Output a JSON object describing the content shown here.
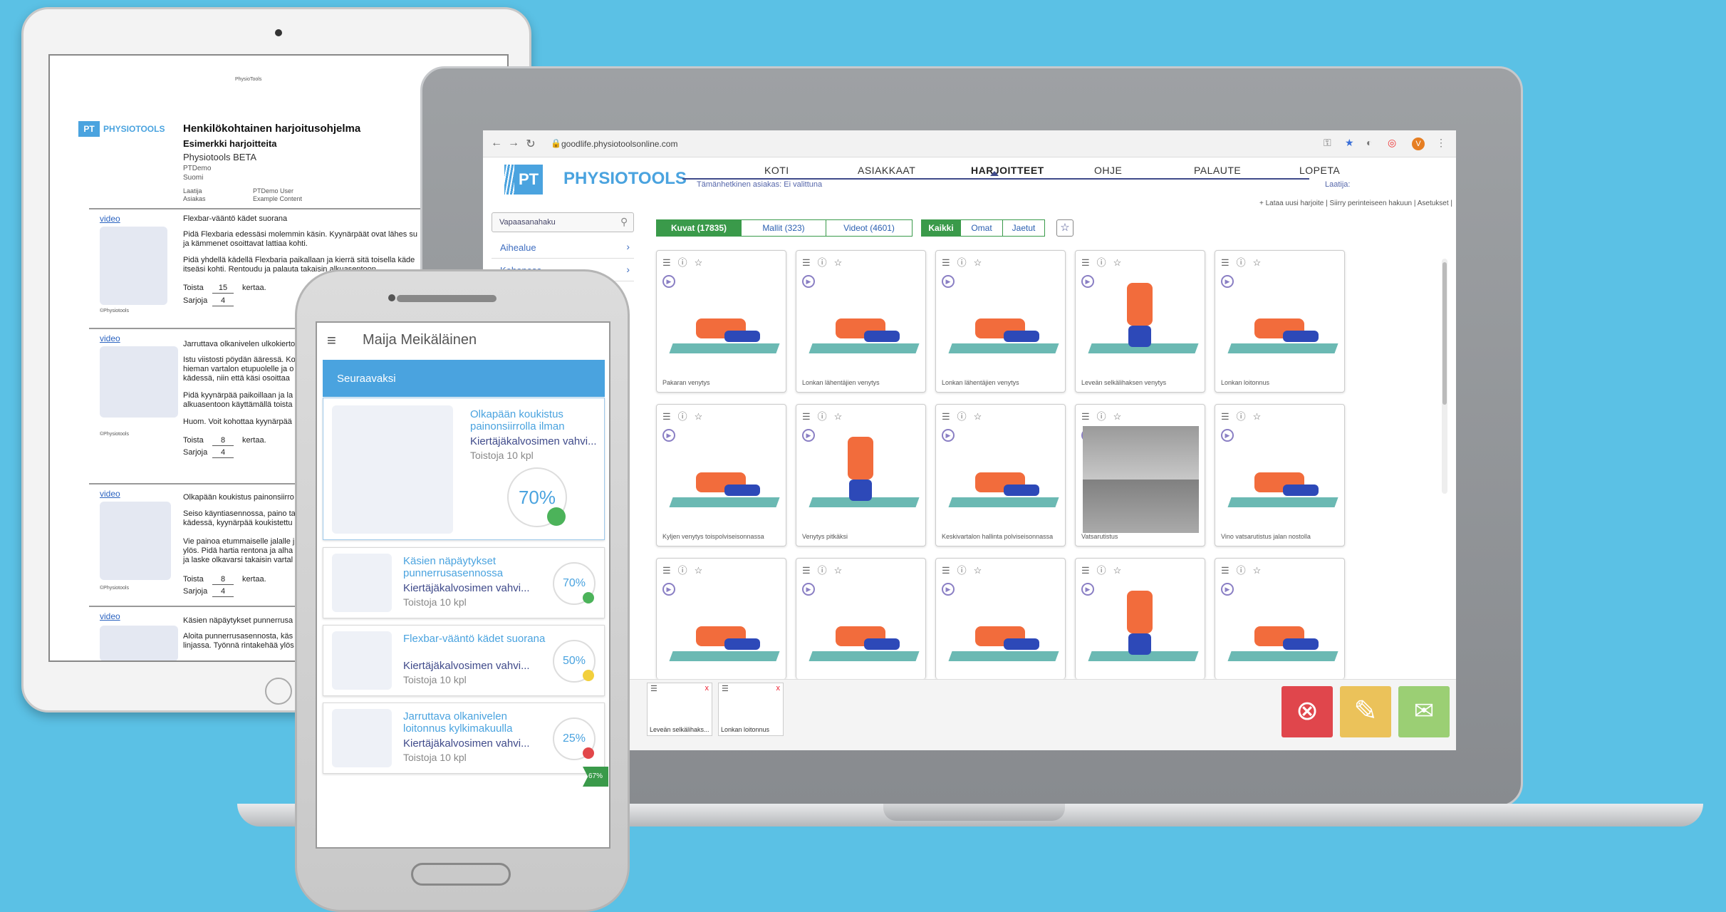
{
  "tablet": {
    "doc_brand": "PHYSIOTOOLS",
    "doc_logo_abbr": "PT",
    "doc_header_small": "PhysioTools",
    "title": "Henkilökohtainen harjoitusohjelma",
    "subtitle": "Esimerkki harjoitteita",
    "org": "Physiotools BETA",
    "org_line2": "PTDemo",
    "country": "Suomi",
    "creator_label": "Laatija",
    "creator_value": "PTDemo User",
    "client_label": "Asiakas",
    "client_value": "Example Content",
    "copyright": "©Physiotools",
    "exercises": [
      {
        "video": "video",
        "name": "Flexbar-vääntö kädet suorana",
        "text": [
          "Pidä Flexbaria edessäsi molemmin käsin. Kyynärpäät ovat lähes su",
          "ja kämmenet osoittavat lattiaa kohti.",
          "",
          "Pidä yhdellä kädellä Flexbaria paikallaan ja kierrä sitä toisella käde",
          "itseäsi kohti. Rentoudu ja palauta takaisin alkuasentoon."
        ],
        "reps_label": "Toista",
        "reps": "15",
        "reps_unit": "kertaa.",
        "sets_label": "Sarjoja",
        "sets": "4"
      },
      {
        "video": "video",
        "name": "Jarruttava olkanivelen ulkokierto",
        "text": [
          "Istu viistosti pöydän ääressä. Ko",
          "hieman vartalon etupuolelle ja o",
          "kädessä, niin että käsi osoittaa",
          "",
          "Pidä kyynärpää paikoillaan ja la",
          "alkuasentoon käyttämällä toista",
          "",
          "Huom. Voit kohottaa kyynärpää"
        ],
        "reps_label": "Toista",
        "reps": "8",
        "reps_unit": "kertaa.",
        "sets_label": "Sarjoja",
        "sets": "4"
      },
      {
        "video": "video",
        "name": "Olkapään koukistus painonsiirro",
        "text": [
          "Seiso käyntiasennossa, paino ta",
          "kädessä, kyynärpää koukistettu",
          "",
          "Vie painoa etummaiselle jalalle j",
          "ylös. Pidä hartia rentona ja alha",
          "ja laske olkavarsi takaisin vartal"
        ],
        "reps_label": "Toista",
        "reps": "8",
        "reps_unit": "kertaa.",
        "sets_label": "Sarjoja",
        "sets": "4"
      },
      {
        "video": "video",
        "name": "Käsien näpäytykset punnerrusa",
        "text": [
          "Aloita punnerrusasennosta, käs",
          "linjassa. Työnnä rintakehää ylös"
        ]
      }
    ]
  },
  "browser": {
    "url": "goodlife.physiotoolsonline.com",
    "user_initial": "V"
  },
  "app": {
    "logo_abbr": "PT",
    "brand": "PHYSIOTOOLS",
    "current_client": "Tämänhetkinen asiakas: Ei valittuna",
    "creator": "Laatija:",
    "nav": [
      "KOTI",
      "ASIAKKAAT",
      "HARJOITTEET",
      "OHJE",
      "PALAUTE",
      "LOPETA"
    ],
    "top_links": "+ Lataa uusi harjoite | Siirry perinteiseen hakuun | Asetukset |",
    "search_placeholder": "Vapaasanahaku",
    "sidebar": [
      "Aihealue",
      "Kehonosa"
    ],
    "media_tabs": [
      "Kuvat (17835)",
      "Mallit (323)",
      "Videot (4601)"
    ],
    "owner_tabs": [
      "Kaikki",
      "Omat",
      "Jaetut"
    ],
    "cards": [
      "Pakaran venytys",
      "Lonkan lähentäjien venytys",
      "Lonkan lähentäjien venytys",
      "Leveän selkälihaksen venytys",
      "Lonkan loitonnus",
      "Kyljen venytys toispolviseisonnassa",
      "Venytys pitkäksi",
      "Keskivartalon hallinta polviseisonnassa",
      "Vatsarutistus",
      "Vino vatsarutistus jalan nostolla",
      "",
      "",
      "",
      "",
      ""
    ],
    "tray": [
      "Leveän selkälihaks...",
      "Lonkan loitonnus"
    ]
  },
  "phone": {
    "user": "Maija  Meikäläinen",
    "next_label": "Seuraavaksi",
    "items": [
      {
        "title": "Olkapään koukistus painonsiirrolla ilman",
        "sub": "Kiertäjäkalvosimen vahvi...",
        "reps": "Toistoja 10 kpl",
        "pct": "70%",
        "color": "#4cb35a"
      },
      {
        "title": "Käsien näpäytykset punnerrusasennossa",
        "sub": "Kiertäjäkalvosimen vahvi...",
        "reps": "Toistoja 10 kpl",
        "pct": "70%",
        "color": "#4cb35a"
      },
      {
        "title": "Flexbar-vääntö kädet suorana",
        "sub": "Kiertäjäkalvosimen vahvi...",
        "reps": "Toistoja 10 kpl",
        "pct": "50%",
        "color": "#f2cf3c"
      },
      {
        "title": "Jarruttava olkanivelen loitonnus kylkimakuulla",
        "sub": "Kiertäjäkalvosimen vahvi...",
        "reps": "Toistoja 10 kpl",
        "pct": "25%",
        "color": "#e2474a"
      }
    ],
    "overall_pct": "67%"
  },
  "colors": {
    "background": "#5bc1e5",
    "brand": "#4aa3df",
    "nav_dark": "#3f4a8a",
    "tab_green": "#3a9a4a",
    "cancel": "#e0464c",
    "edit": "#ebc25a",
    "send": "#9bcf74"
  }
}
